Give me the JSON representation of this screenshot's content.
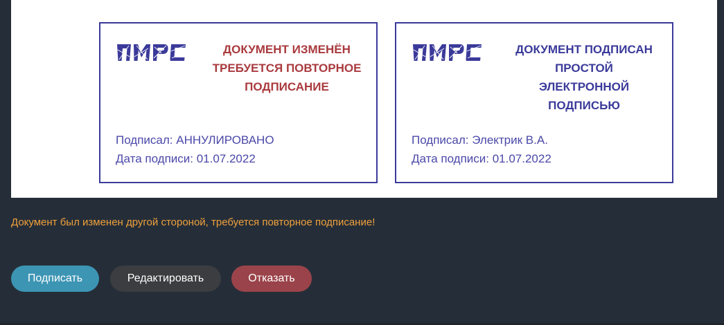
{
  "stamps": [
    {
      "logo_text": "ПМРС",
      "title_lines": [
        "ДОКУМЕНТ ИЗМЕНЁН",
        "ТРЕБУЕТСЯ ПОВТОРНОЕ",
        "ПОДПИСАНИЕ"
      ],
      "signer": "Подписал: АННУЛИРОВАНО",
      "date": "Дата подписи: 01.07.2022",
      "title_color": "#a93a3e"
    },
    {
      "logo_text": "ПМРС",
      "title_lines": [
        "ДОКУМЕНТ ПОДПИСАН",
        "ПРОСТОЙ",
        "ЭЛЕКТРОННОЙ",
        "ПОДПИСЬЮ"
      ],
      "signer": "Подписал: Электрик В.А.",
      "date": "Дата подписи: 01.07.2022",
      "title_color": "#3b3a9a"
    }
  ],
  "warning": "Документ был изменен другой стороной, требуется повторное подписание!",
  "buttons": {
    "sign": "Подписать",
    "edit": "Редактировать",
    "refuse": "Отказать"
  },
  "colors": {
    "stamp_border": "#3b3a9a",
    "warning": "#f0a03c",
    "sign_button": "#3d95b4",
    "edit_button": "#3b3d40",
    "refuse_button": "#9b434a",
    "background": "#252e38"
  }
}
